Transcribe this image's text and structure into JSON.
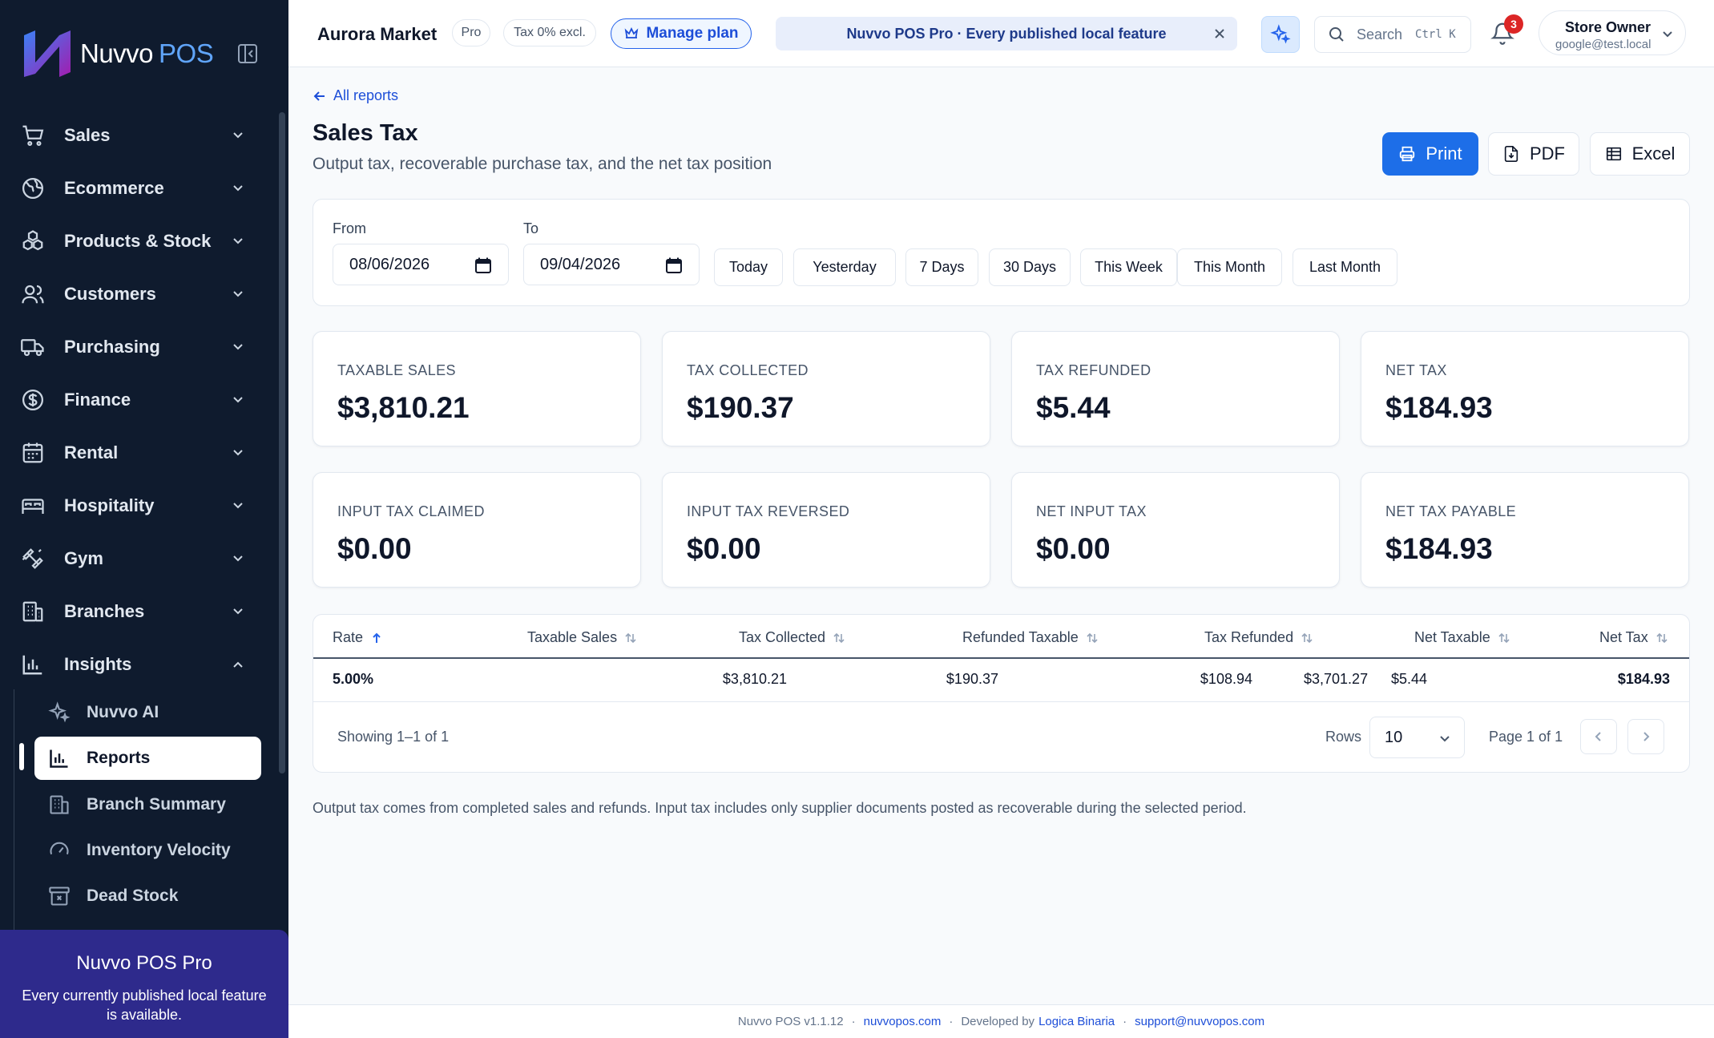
{
  "brand": {
    "name": "Nuvvo",
    "suffix": "POS"
  },
  "sidebar": {
    "nav": [
      {
        "label": "Sales",
        "icon": "cart-icon"
      },
      {
        "label": "Ecommerce",
        "icon": "globe-icon"
      },
      {
        "label": "Products & Stock",
        "icon": "boxes-icon"
      },
      {
        "label": "Customers",
        "icon": "users-icon"
      },
      {
        "label": "Purchasing",
        "icon": "truck-icon"
      },
      {
        "label": "Finance",
        "icon": "dollar-circle-icon"
      },
      {
        "label": "Rental",
        "icon": "calendar-icon"
      },
      {
        "label": "Hospitality",
        "icon": "bed-icon"
      },
      {
        "label": "Gym",
        "icon": "dumbbell-icon"
      },
      {
        "label": "Branches",
        "icon": "building-icon"
      },
      {
        "label": "Insights",
        "icon": "bar-chart-icon"
      }
    ],
    "sub_items": [
      {
        "label": "Nuvvo AI",
        "icon": "sparkles-icon"
      },
      {
        "label": "Reports",
        "icon": "bar-chart-icon",
        "active": true
      },
      {
        "label": "Branch Summary",
        "icon": "building-icon"
      },
      {
        "label": "Inventory Velocity",
        "icon": "gauge-icon"
      },
      {
        "label": "Dead Stock",
        "icon": "archive-x-icon"
      }
    ],
    "promo": {
      "title": "Nuvvo POS Pro",
      "text": "Every currently published local feature is available."
    }
  },
  "topbar": {
    "store_name": "Aurora Market",
    "plan_badge": "Pro",
    "tax_badge": "Tax 0% excl.",
    "manage_plan": "Manage plan",
    "banner": "Nuvvo POS Pro · Every published local feature",
    "search_label": "Search",
    "search_shortcut": "Ctrl K",
    "notification_count": "3",
    "user_name": "Store Owner",
    "user_email": "google@test.local"
  },
  "page": {
    "back_link": "All reports",
    "title": "Sales Tax",
    "subtitle": "Output tax, recoverable purchase tax, and the net tax position",
    "actions": {
      "print": "Print",
      "pdf": "PDF",
      "excel": "Excel"
    }
  },
  "filters": {
    "from_label": "From",
    "from_value": "08/06/2026",
    "to_label": "To",
    "to_value": "09/04/2026",
    "presets": [
      "Today",
      "Yesterday",
      "7 Days",
      "30 Days",
      "This Week",
      "This Month",
      "Last Month"
    ]
  },
  "kpis": [
    {
      "label": "TAXABLE SALES",
      "value": "$3,810.21"
    },
    {
      "label": "TAX COLLECTED",
      "value": "$190.37"
    },
    {
      "label": "TAX REFUNDED",
      "value": "$5.44"
    },
    {
      "label": "NET TAX",
      "value": "$184.93"
    },
    {
      "label": "INPUT TAX CLAIMED",
      "value": "$0.00"
    },
    {
      "label": "INPUT TAX REVERSED",
      "value": "$0.00"
    },
    {
      "label": "NET INPUT TAX",
      "value": "$0.00"
    },
    {
      "label": "NET TAX PAYABLE",
      "value": "$184.93"
    }
  ],
  "table": {
    "columns": [
      "Rate",
      "Taxable Sales",
      "Tax Collected",
      "Refunded Taxable",
      "Tax Refunded",
      "Net Taxable",
      "Net Tax"
    ],
    "rows": [
      [
        "5.00%",
        "$3,810.21",
        "$190.37",
        "$108.94",
        "$5.44",
        "$3,701.27",
        "$184.93"
      ]
    ],
    "showing": "Showing 1–1 of 1",
    "rows_label": "Rows",
    "rows_value": "10",
    "page_label": "Page 1 of 1"
  },
  "footnote": "Output tax comes from completed sales and refunds. Input tax includes only supplier documents posted as recoverable during the selected period.",
  "footer": {
    "version": "Nuvvo POS v1.1.12",
    "site": "nuvvopos.com",
    "developed_by": "Developed by",
    "developer": "Logica Binaria",
    "email": "support@nuvvopos.com"
  }
}
